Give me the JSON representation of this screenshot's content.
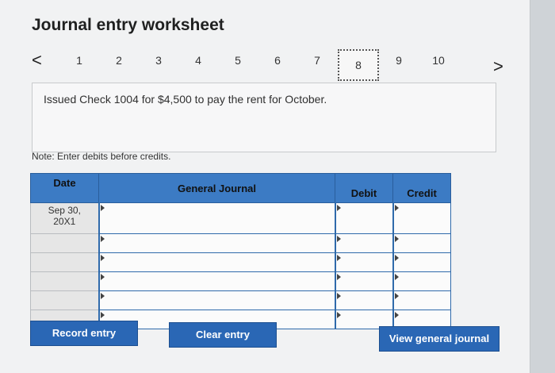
{
  "title": "Journal entry worksheet",
  "nav": {
    "prev": "<",
    "next": ">",
    "steps": [
      "1",
      "2",
      "3",
      "4",
      "5",
      "6",
      "7",
      "8",
      "9",
      "10"
    ],
    "active": "8"
  },
  "description": "Issued Check 1004 for $4,500 to pay the rent for October.",
  "note": "Note: Enter debits before credits.",
  "table": {
    "headers": {
      "date": "Date",
      "journal": "General Journal",
      "debit": "Debit",
      "credit": "Credit"
    },
    "date_line1": "Sep 30,",
    "date_line2": "20X1"
  },
  "buttons": {
    "record": "Record entry",
    "clear": "Clear entry",
    "view": "View general journal"
  }
}
